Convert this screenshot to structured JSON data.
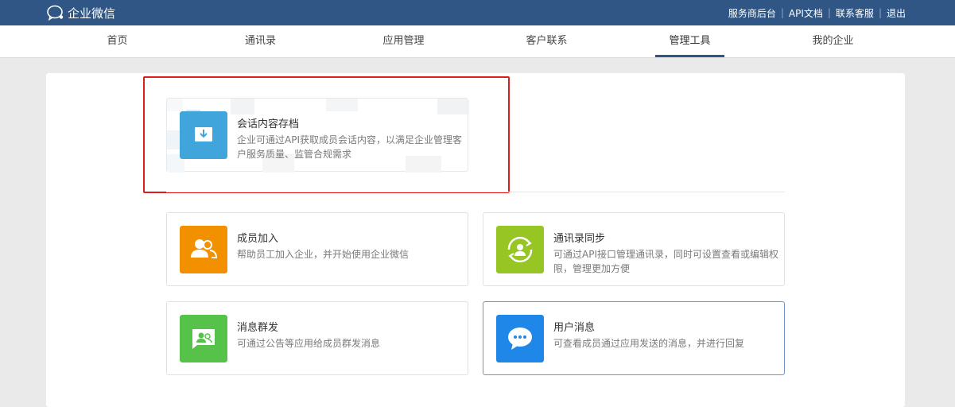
{
  "header": {
    "brand": "企业微信",
    "links": [
      "服务商后台",
      "API文档",
      "联系客服",
      "退出"
    ]
  },
  "nav": {
    "items": [
      "首页",
      "通讯录",
      "应用管理",
      "客户联系",
      "管理工具",
      "我的企业"
    ],
    "active_index": 4
  },
  "featured": {
    "title": "会话内容存档",
    "desc": "企业可通过API获取成员会话内容，以满足企业管理客户服务质量、监管合规需求",
    "icon": "download-archive-icon",
    "color": "#3fa5db"
  },
  "tools": [
    {
      "title": "成员加入",
      "desc": "帮助员工加入企业，并开始使用企业微信",
      "icon": "member-join-icon",
      "color": "#f39000"
    },
    {
      "title": "通讯录同步",
      "desc": "可通过API接口管理通讯录，同时可设置查看或编辑权限，管理更加方便",
      "icon": "contact-sync-icon",
      "color": "#96c524"
    },
    {
      "title": "消息群发",
      "desc": "可通过公告等应用给成员群发消息",
      "icon": "broadcast-message-icon",
      "color": "#57c24a"
    },
    {
      "title": "用户消息",
      "desc": "可查看成员通过应用发送的消息，并进行回复",
      "icon": "user-message-icon",
      "color": "#1f87e8"
    }
  ],
  "colors": {
    "topbar": "#2f5684",
    "highlight": "#d81e1e",
    "selected_border": "#6f95c3"
  }
}
